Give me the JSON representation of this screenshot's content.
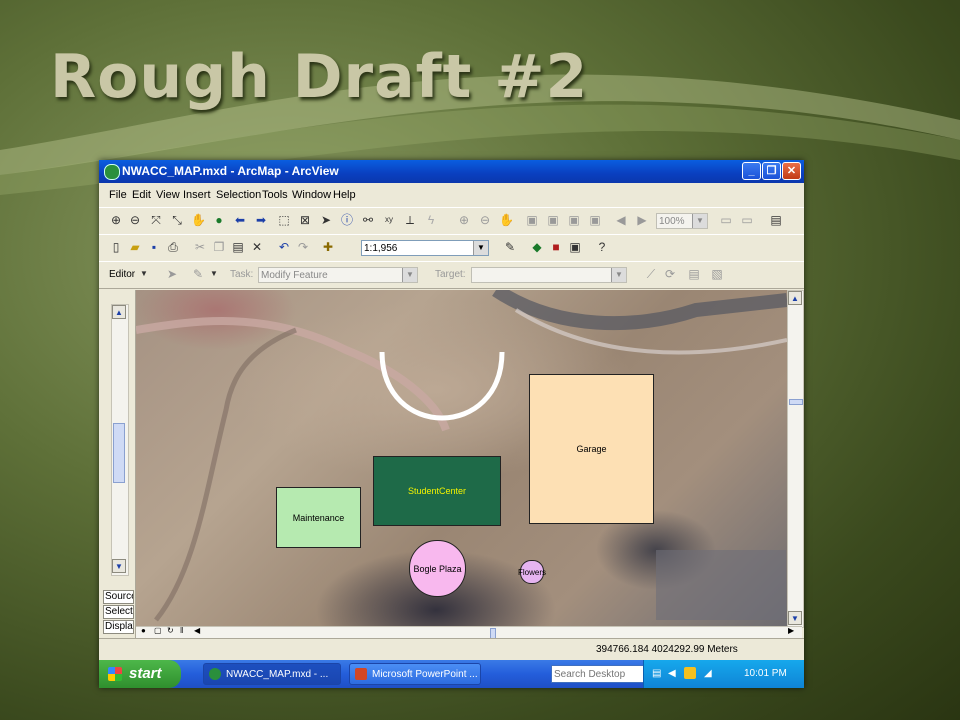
{
  "slide": {
    "title": "Rough Draft #2"
  },
  "window": {
    "title": "NWACC_MAP.mxd - ArcMap - ArcView",
    "minimize": "_",
    "maximize": "❐",
    "close": "✕"
  },
  "menu": [
    "File",
    "Edit",
    "View",
    "Insert",
    "Selection",
    "Tools",
    "Window",
    "Help"
  ],
  "standard_toolbar": {
    "scale": "1:1,956",
    "zoom": "100%"
  },
  "editor_toolbar": {
    "editor_label": "Editor",
    "task_label": "Task:",
    "task_value": "Modify Feature",
    "target_label": "Target:",
    "target_value": ""
  },
  "toc": {
    "tabs": [
      "Source",
      "Selection",
      "Display"
    ]
  },
  "map": {
    "features": {
      "garage": "Garage",
      "student_center": "StudentCenter",
      "maintenance": "Maintenance",
      "bogle_plaza": "Bogle Plaza",
      "flowers": "Flowers"
    },
    "colors": {
      "garage": "#fde0b4",
      "student_center": "#1e6a48",
      "maintenance": "#b6eab0",
      "bogle_plaza": "#f8b8ee",
      "flowers": "#e6b4f0"
    }
  },
  "status": {
    "coordinates": "394766.184  4024292.99 Meters"
  },
  "taskbar": {
    "start": "start",
    "items": [
      "NWACC_MAP.mxd - ...",
      "Microsoft PowerPoint ..."
    ],
    "search_placeholder": "Search Desktop",
    "clock": "10:01 PM"
  }
}
